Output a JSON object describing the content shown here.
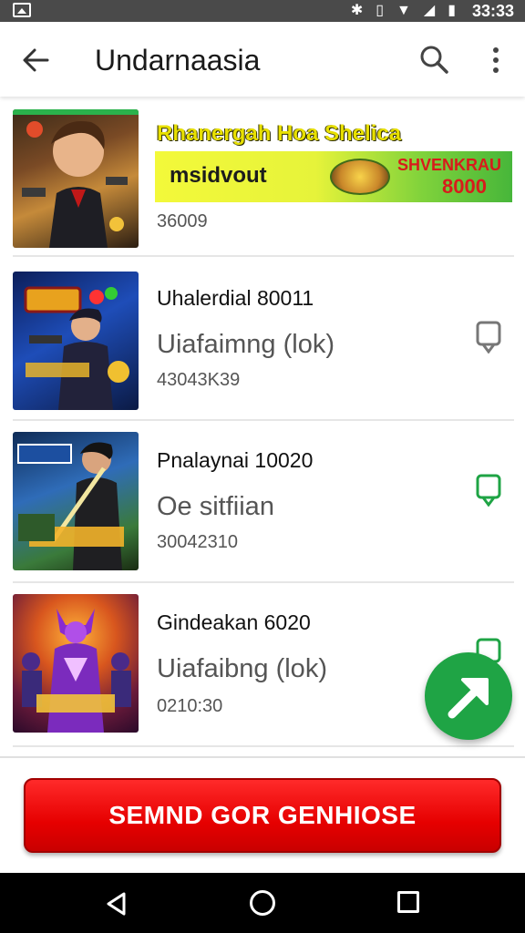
{
  "status_bar": {
    "time": "33:33",
    "icons": [
      "image-icon",
      "bluetooth-icon",
      "vibrate-icon",
      "wifi-icon",
      "signal-icon",
      "battery-icon"
    ]
  },
  "app_bar": {
    "title": "Undarnaasia",
    "back_icon": "arrow-left-icon",
    "search_icon": "search-icon",
    "more_icon": "more-vert-icon"
  },
  "items": [
    {
      "type": "promo",
      "title": "Rhanergah Hoa Shelica",
      "banner_left": "msidvout",
      "banner_right_top": "SHVENKRAU",
      "banner_right_bottom": "8000",
      "value": "36009"
    },
    {
      "title": "Uhalerdial 80011",
      "status": "Uiafaimng (lok)",
      "code": "43043K39",
      "status_color": "#777777"
    },
    {
      "title": "Pnalaynai 10020",
      "status": "Oe sitfiian",
      "code": "30042310",
      "status_color": "#1fa445"
    },
    {
      "title": "Gindeakan 6020",
      "status": "Uiafaibng (lok)",
      "code": "0210:30",
      "status_color": "#1fa445"
    }
  ],
  "fab": {
    "icon": "arrow-up-right-icon",
    "color": "#1fa445"
  },
  "cta": {
    "label": "SEMND GOR GENHIOSE",
    "color": "#e60000"
  },
  "nav_bar": {
    "back": "nav-back-icon",
    "home": "nav-home-icon",
    "recents": "nav-recents-icon"
  }
}
